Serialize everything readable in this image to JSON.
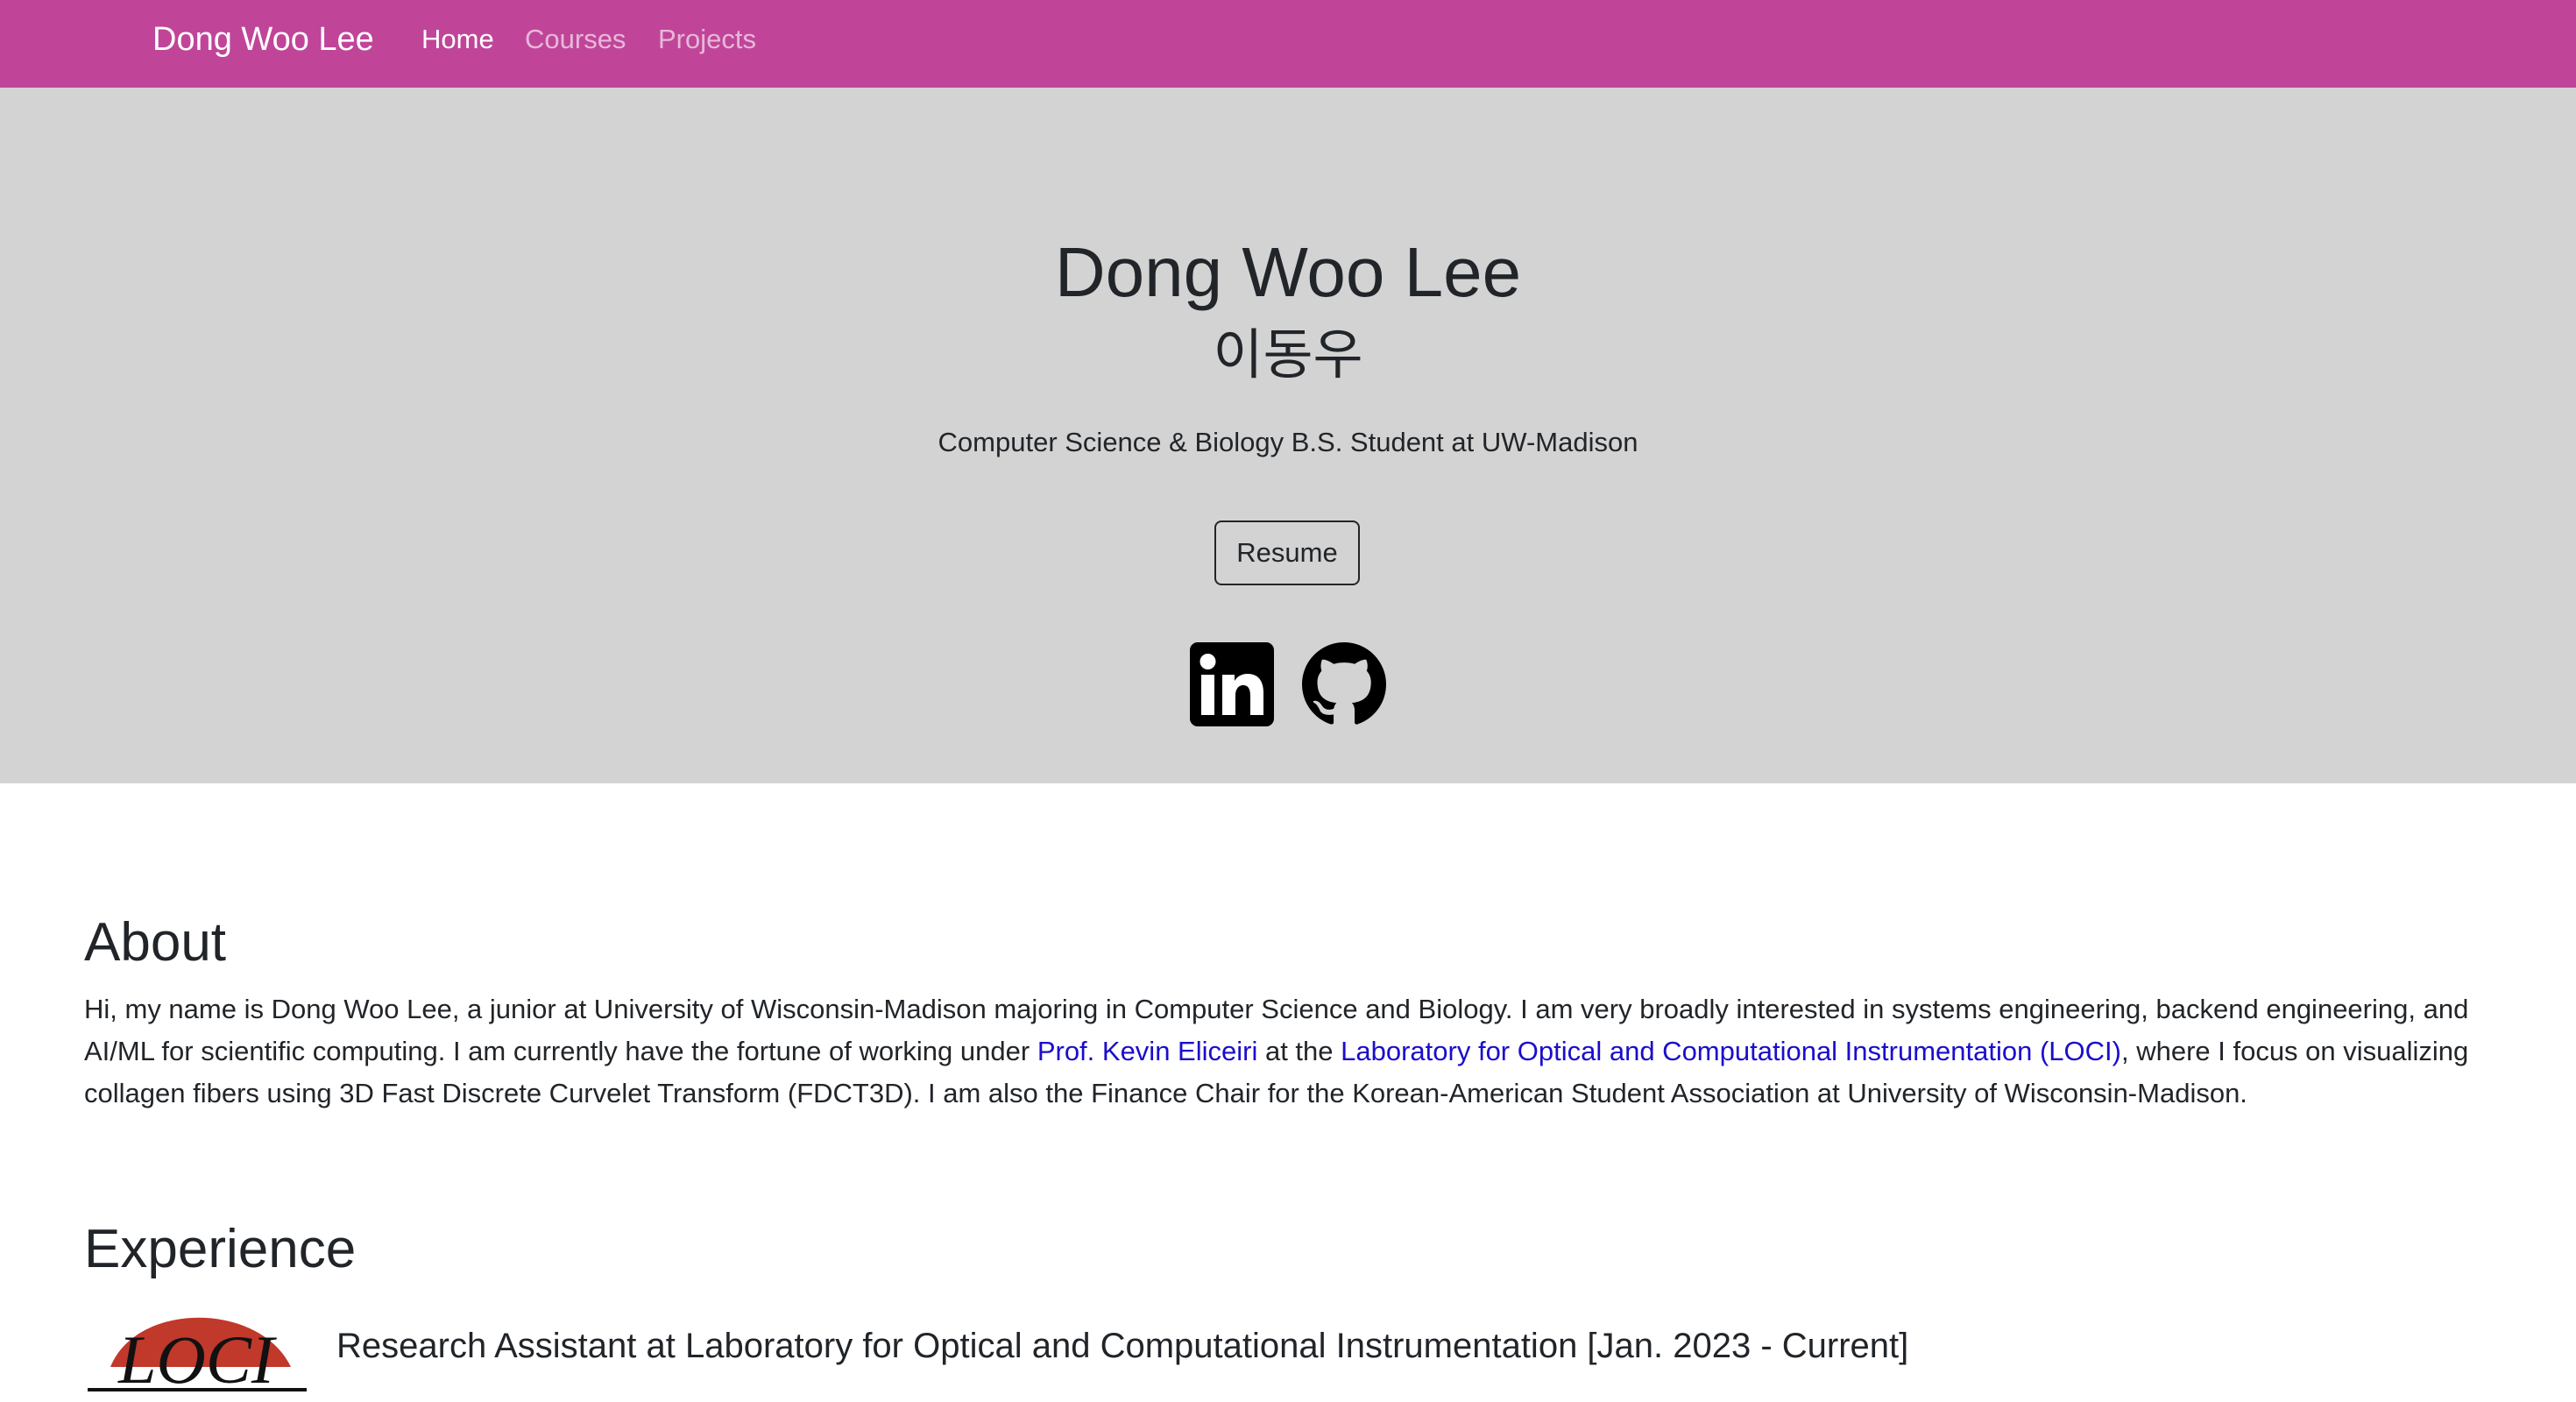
{
  "nav": {
    "brand": "Dong Woo Lee",
    "links": [
      {
        "label": "Home",
        "active": true
      },
      {
        "label": "Courses",
        "active": false
      },
      {
        "label": "Projects",
        "active": false
      }
    ],
    "background": "#c04599"
  },
  "hero": {
    "name": "Dong Woo Lee",
    "name_korean": "이동우",
    "tagline": "Computer Science & Biology B.S. Student at UW-Madison",
    "resume_label": "Resume",
    "social": [
      {
        "icon": "linkedin-icon"
      },
      {
        "icon": "github-icon"
      }
    ],
    "background": "#d3d3d3"
  },
  "about": {
    "heading": "About",
    "text_1": "Hi, my name is Dong Woo Lee, a junior at University of Wisconsin-Madison majoring in Computer Science and Biology. I am very broadly interested in systems engineering, backend engineering, and AI/ML for scientific computing. I am currently have the fortune of working under ",
    "link_1": "Prof. Kevin Eliceiri",
    "text_2": " at the ",
    "link_2": "Laboratory for Optical and Computational Instrumentation (LOCI)",
    "text_3": ", where I focus on visualizing collagen fibers using 3D Fast Discrete Curvelet Transform (FDCT3D). I am also the Finance Chair for the Korean-American Student Association at University of Wisconsin-Madison.",
    "link_color": "#1a0dcc"
  },
  "experience": {
    "heading": "Experience",
    "items": [
      {
        "logo_text": "LOCI",
        "title": "Research Assistant at Laboratory for Optical and Computational Instrumentation [Jan. 2023 - Current]"
      }
    ]
  }
}
